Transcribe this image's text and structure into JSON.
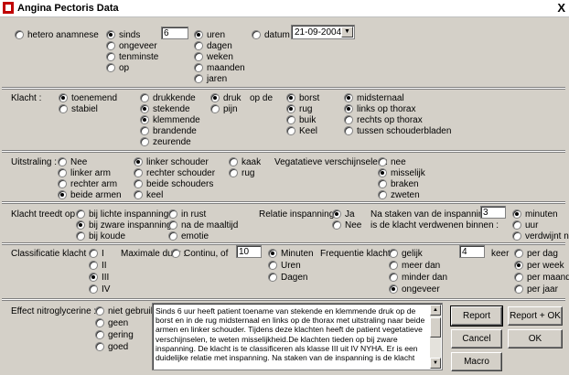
{
  "title": "Angina Pectoris Data",
  "close": "X",
  "anamnese": {
    "hetero": "hetero anamnese",
    "sinds": "sinds",
    "ongeveer": "ongeveer",
    "tenminste": "tenminste",
    "op": "op",
    "duur_value": "6",
    "uren": "uren",
    "dagen": "dagen",
    "weken": "weken",
    "maanden": "maanden",
    "jaren": "jaren",
    "datum": "datum",
    "datum_value": "21-09-2004"
  },
  "klacht": {
    "label": "Klacht :",
    "toenemend": "toenemend",
    "stabiel": "stabiel",
    "drukkende": "drukkende",
    "stekende": "stekende",
    "klemmende": "klemmende",
    "brandende": "brandende",
    "zeurende": "zeurende",
    "druk": "druk",
    "pijn": "pijn",
    "op_de": "op de",
    "borst": "borst",
    "rug": "rug",
    "buik": "buik",
    "keel": "Keel",
    "midsternaal": "midsternaal",
    "links": "links op thorax",
    "rechts": "rechts op thorax",
    "tussen": "tussen schouderbladen"
  },
  "uitstraling": {
    "label": "Uitstraling :",
    "nee": "Nee",
    "linker_arm": "linker arm",
    "rechter_arm": "rechter arm",
    "beide_armen": "beide armen",
    "linker_schouder": "linker schouder",
    "rechter_schouder": "rechter schouder",
    "beide_schouders": "beide schouders",
    "keel": "keel",
    "kaak": "kaak",
    "rug": "rug",
    "veg_label": "Vegatatieve verschijnselen :",
    "veg_nee": "nee",
    "misselijk": "misselijk",
    "braken": "braken",
    "zweten": "zweten"
  },
  "treedt": {
    "label": "Klacht treedt op :",
    "lichte": "bij lichte inspanning",
    "zware": "bij zware inspanning",
    "koude": "bij koude",
    "rust": "in rust",
    "maaltijd": "na de maaltijd",
    "emotie": "emotie",
    "relatie": "Relatie inspanning :",
    "ja": "Ja",
    "nee": "Nee",
    "staken1": "Na staken van de inspanning",
    "staken2": "is de klacht verdwenen binnen :",
    "staken_value": "3",
    "minuten": "minuten",
    "uur": "uur",
    "verdwijnt": "verdwijnt niet"
  },
  "classificatie": {
    "label": "Classificatie klacht :",
    "I": "I",
    "II": "II",
    "III": "III",
    "IV": "IV",
    "max_duur": "Maximale duur :",
    "continu": "Continu, of",
    "duur_value": "10",
    "minuten": "Minuten",
    "uren": "Uren",
    "dagen": "Dagen",
    "freq": "Frequentie klacht :",
    "gelijk": "gelijk",
    "meer": "meer dan",
    "minder": "minder dan",
    "ongeveer": "ongeveer",
    "freq_value": "4",
    "keer": "keer",
    "per_dag": "per dag",
    "per_week": "per week",
    "per_maand": "per maand",
    "per_jaar": "per jaar"
  },
  "effect": {
    "label": "Effect nitroglycerine :",
    "niet": "niet gebruikt",
    "geen": "geen",
    "gering": "gering",
    "goed": "goed",
    "memo": "Sinds 6 uur heeft patient toename van stekende en klemmende druk op de borst en in de rug midsternaal en links op de thorax met uitstraling naar beide armen en linker schouder. Tijdens deze klachten heeft de patient vegetatieve verschijnselen, te weten misselijkheid.De klachten tieden op bij zware inspanning. De klacht is te classificeren als klasse III uit IV NYHA. Er is een duidelijke relatie met inspanning. Na staken van de inspanning is de klacht"
  },
  "buttons": {
    "report": "Report",
    "report_ok": "Report + OK",
    "cancel": "Cancel",
    "ok": "OK",
    "macro": "Macro"
  }
}
